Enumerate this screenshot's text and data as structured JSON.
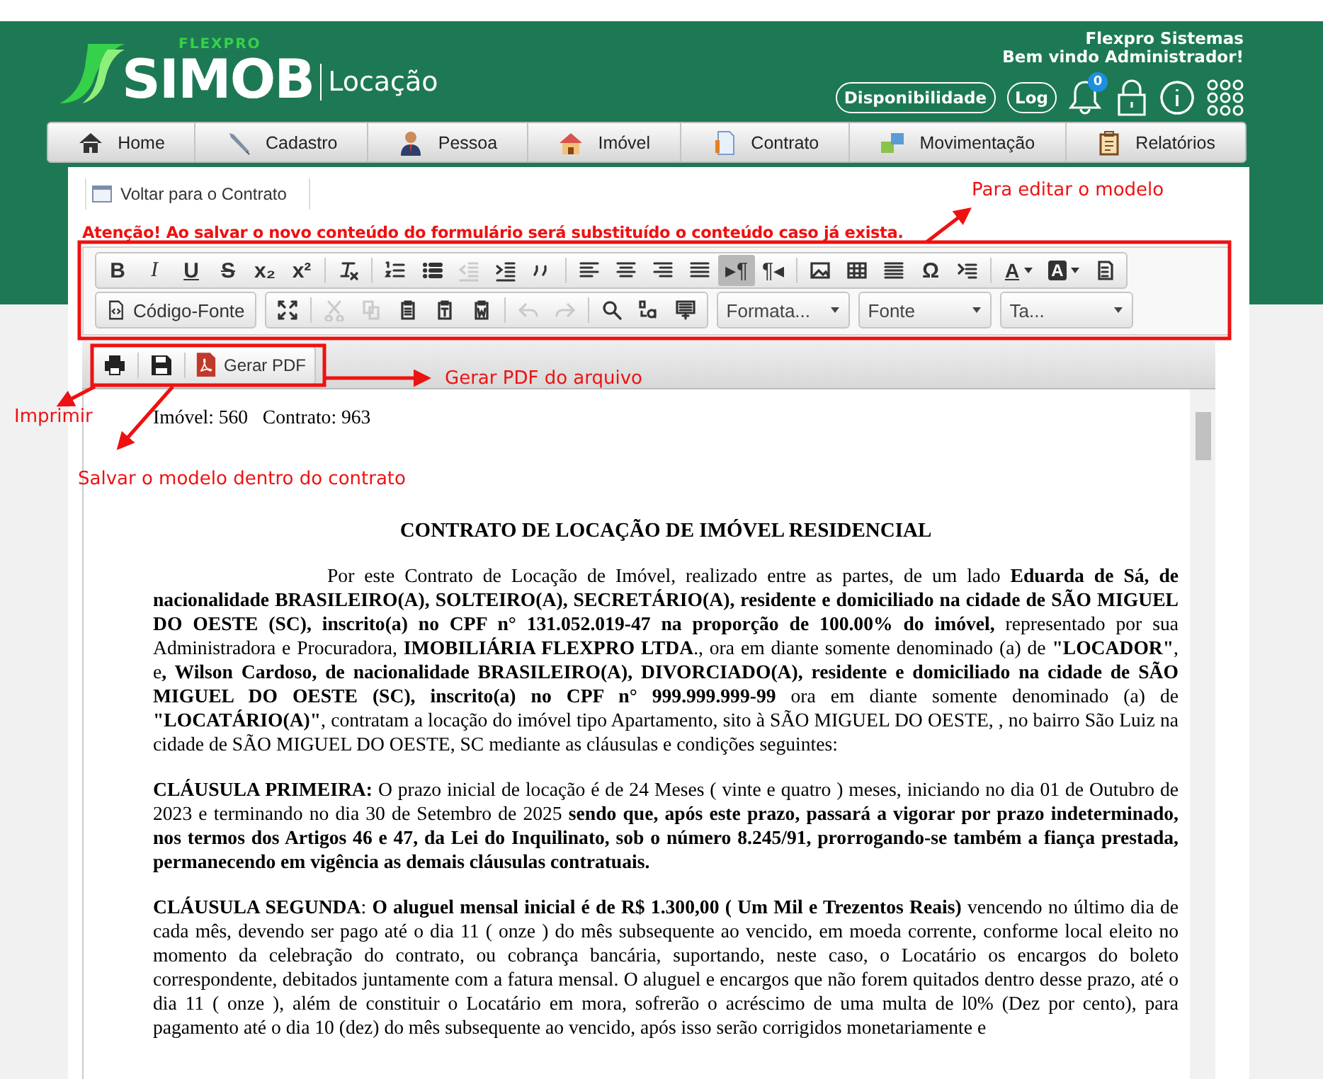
{
  "header": {
    "logo": {
      "small": "FLEXPRO",
      "brand": "SIMOB",
      "product": "Locação"
    },
    "company": "Flexpro Sistemas",
    "welcome": "Bem vindo Administrador!",
    "buttons": [
      "Disponibilidade",
      "Log"
    ],
    "notifications": "0"
  },
  "nav": [
    {
      "label": "Home",
      "kind": "home"
    },
    {
      "label": "Cadastro",
      "kind": "pencil"
    },
    {
      "label": "Pessoa",
      "kind": "person"
    },
    {
      "label": "Imóvel",
      "kind": "house"
    },
    {
      "label": "Contrato",
      "kind": "document"
    },
    {
      "label": "Movimentação",
      "kind": "transfer"
    },
    {
      "label": "Relatórios",
      "kind": "clipboard"
    }
  ],
  "back_link": "Voltar para o Contrato",
  "warning": "Atenção! Ao salvar o novo conteúdo do formulário será substituído o conteúdo caso já exista.",
  "toolbar": [
    [
      {
        "groups": [
          [
            {
              "kind": "bold",
              "text": "B",
              "active": false,
              "disabled": false
            },
            {
              "kind": "italic",
              "text": "I",
              "active": false,
              "disabled": false
            },
            {
              "kind": "underline",
              "text": "U",
              "active": false,
              "disabled": false
            },
            {
              "kind": "strike",
              "text": "S",
              "active": false,
              "disabled": false
            },
            {
              "kind": "subscript",
              "text": "x₂",
              "active": false,
              "disabled": false
            },
            {
              "kind": "superscript",
              "text": "x²",
              "active": false,
              "disabled": false
            }
          ],
          [
            {
              "kind": "clear",
              "active": false,
              "disabled": false
            }
          ],
          [
            {
              "kind": "numbered",
              "active": false,
              "disabled": false
            },
            {
              "kind": "bulleted",
              "active": false,
              "disabled": false
            },
            {
              "kind": "outdent",
              "active": false,
              "disabled": true
            },
            {
              "kind": "indent",
              "active": false,
              "disabled": false
            },
            {
              "kind": "quote",
              "active": false,
              "disabled": false
            }
          ],
          [
            {
              "kind": "left",
              "active": false,
              "disabled": false
            },
            {
              "kind": "center",
              "active": false,
              "disabled": false
            },
            {
              "kind": "right",
              "active": false,
              "disabled": false
            },
            {
              "kind": "justify",
              "active": false,
              "disabled": false
            },
            {
              "kind": "ltr",
              "text": "▸¶",
              "active": true,
              "disabled": false
            },
            {
              "kind": "rtl",
              "text": "¶◂",
              "active": false,
              "disabled": false
            }
          ],
          [
            {
              "kind": "image",
              "active": false,
              "disabled": false
            },
            {
              "kind": "table",
              "active": false,
              "disabled": false
            },
            {
              "kind": "rule",
              "active": false,
              "disabled": false
            },
            {
              "kind": "symbol",
              "text": "Ω",
              "active": false,
              "disabled": false
            },
            {
              "kind": "pagebreak",
              "active": false,
              "disabled": false
            }
          ],
          [
            {
              "kind": "color",
              "text": "A",
              "active": false,
              "disabled": false
            },
            {
              "kind": "bgcolor",
              "text": "A",
              "active": false,
              "disabled": false
            },
            {
              "kind": "blocks",
              "active": false,
              "disabled": false
            }
          ]
        ]
      }
    ],
    [
      {
        "groups": [
          [
            {
              "kind": "source",
              "text": "Código-Fonte",
              "active": false,
              "disabled": false
            }
          ]
        ]
      },
      {
        "groups": [
          [
            {
              "kind": "maximize",
              "active": false,
              "disabled": false
            }
          ],
          [
            {
              "kind": "cut",
              "active": false,
              "disabled": true
            },
            {
              "kind": "copy",
              "active": false,
              "disabled": true
            },
            {
              "kind": "paste",
              "active": false,
              "disabled": false
            },
            {
              "kind": "pastetext",
              "active": false,
              "disabled": false
            },
            {
              "kind": "pasteword",
              "active": false,
              "disabled": false
            }
          ],
          [
            {
              "kind": "undo",
              "active": false,
              "disabled": true
            },
            {
              "kind": "redo",
              "active": false,
              "disabled": true
            }
          ],
          [
            {
              "kind": "find",
              "active": false,
              "disabled": false
            },
            {
              "kind": "replace",
              "active": false,
              "disabled": false
            },
            {
              "kind": "selectall",
              "active": false,
              "disabled": false
            }
          ]
        ]
      },
      {
        "groups": [
          [
            {
              "kind": "combo",
              "text": "Formata...",
              "active": false,
              "disabled": false
            }
          ]
        ]
      },
      {
        "groups": [
          [
            {
              "kind": "combo",
              "text": "Fonte",
              "active": false,
              "disabled": false
            }
          ]
        ]
      },
      {
        "groups": [
          [
            {
              "kind": "combo",
              "text": "Ta...",
              "active": false,
              "disabled": false
            }
          ]
        ]
      }
    ]
  ],
  "doc_toolbar": [
    {
      "kind": "print"
    },
    {
      "kind": "save"
    },
    {
      "kind": "pdf",
      "text": "Gerar PDF"
    }
  ],
  "document": {
    "info": "Imóvel: 560   Contrato: 963",
    "title": "CONTRATO DE LOCAÇÃO DE IMÓVEL RESIDENCIAL",
    "paragraphs": [
      {
        "indent": true,
        "text": "Por este Contrato de Locação de Imóvel, realizado entre as partes, de um lado **Eduarda de Sá, de nacionalidade BRASILEIRO(A), SOLTEIRO(A), SECRETÁRIO(A), residente e domiciliado na cidade de SÃO MIGUEL DO OESTE (SC), inscrito(a) no CPF n° 131.052.019-47 na proporção de 100.00% do imóvel,** representado por sua Administradora e Procuradora, **IMOBILIÁRIA FLEXPRO LTDA**., ora em diante somente denominado (a) de **\"LOCADOR\"**, e**, Wilson Cardoso, de nacionalidade BRASILEIRO(A), DIVORCIADO(A), residente e domiciliado na cidade de SÃO MIGUEL DO OESTE (SC), inscrito(a) no CPF n° 999.999.999-99** ora em diante somente denominado (a) de **\"LOCATÁRIO(A)\"**, contratam a locação do imóvel tipo Apartamento, sito à SÃO MIGUEL DO OESTE, , no bairro São Luiz na cidade de SÃO MIGUEL DO OESTE, SC mediante as cláusulas e condições seguintes:"
      },
      {
        "indent": false,
        "text": "**CLÁUSULA PRIMEIRA:** O prazo inicial de locação é de 24 Meses ( vinte e quatro ) meses, iniciando no dia 01 de Outubro de 2023 e terminando no dia 30 de Setembro de 2025 **sendo que, após este prazo, passará a vigorar por prazo indeterminado, nos termos dos Artigos 46 e 47, da Lei do Inquilinato, sob o número 8.245/91, prorrogando-se também a fiança prestada, permanecendo em vigência as demais cláusulas contratuais.**"
      },
      {
        "indent": false,
        "text": "**CLÁUSULA SEGUNDA**: **O aluguel mensal inicial é de R$ 1.300,00 ( Um Mil e Trezentos Reais)** vencendo no último dia de cada mês, devendo ser pago até o dia 11 ( onze ) do mês subsequente ao vencido, em moeda corrente, conforme local eleito no momento da celebração do contrato, ou cobrança bancária, suportando, neste caso, o Locatário os encargos do boleto correspondente, debitados juntamente com a fatura mensal. O aluguel e encargos que não forem quitados dentro desse prazo, até o dia 11 ( onze ), além de constituir o Locatário em mora, sofrerão o acréscimo de uma multa de l0% (Dez por cento), para pagamento até o dia 10 (dez) do mês subsequente ao vencido, após isso serão corrigidos monetariamente e"
      }
    ]
  },
  "annotations": [
    "Para editar o modelo",
    "Gerar PDF do arquivo",
    "Imprimir",
    "Salvar o modelo dentro do contrato"
  ]
}
